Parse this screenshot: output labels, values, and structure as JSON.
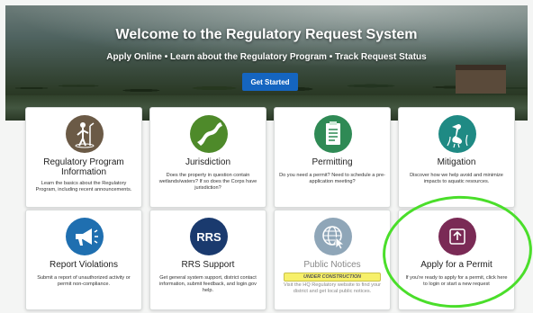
{
  "hero": {
    "title": "Welcome to the Regulatory Request System",
    "subtitle": "Apply Online • Learn about the Regulatory Program • Track Request Status",
    "cta_label": "Get Started"
  },
  "cards": [
    {
      "title": "Regulatory Program Information",
      "desc": "Learn the basics about the Regulatory Program, including recent announcements.",
      "icon": "person-surveyor-icon",
      "color": "#6b5a46"
    },
    {
      "title": "Jurisdiction",
      "desc": "Does the property in question contain wetlands/waters? If so does the Corps have jurisdiction?",
      "icon": "river-icon",
      "color": "#4e8a2a"
    },
    {
      "title": "Permitting",
      "desc": "Do you need a permit? Need to schedule a pre-application meeting?",
      "icon": "checklist-icon",
      "color": "#2f8a55"
    },
    {
      "title": "Mitigation",
      "desc": "Discover how we help avoid and minimize impacts to aquatic resources.",
      "icon": "heron-icon",
      "color": "#1f8a84"
    },
    {
      "title": "Report Violations",
      "desc": "Submit a report of unauthorized activity or permit non-compliance.",
      "icon": "megaphone-icon",
      "color": "#1f6fb0"
    },
    {
      "title": "RRS Support",
      "desc": "Get general system support, district contact information, submit feedback, and login.gov help.",
      "icon": "rrs-icon",
      "icon_text": "RRS",
      "color": "#1a3a6e"
    },
    {
      "title": "Public Notices",
      "badge": "UNDER CONSTRUCTION",
      "desc": "Visit the HQ Regulatory website to find your district and get local public notices.",
      "icon": "globe-cursor-icon",
      "color": "#8fa6b8"
    },
    {
      "title": "Apply for a Permit",
      "desc": "If you're ready to apply for a permit, click here to login or start a new request",
      "icon": "upload-icon",
      "color": "#7a2a55"
    }
  ],
  "highlight_color": "#4ade2a"
}
